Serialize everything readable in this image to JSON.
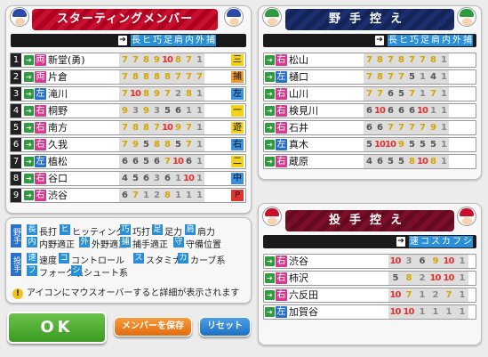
{
  "starting": {
    "title": "スターティングメンバー",
    "header_labels": [
      "長",
      "ヒ",
      "巧",
      "足",
      "肩",
      "内",
      "外",
      "捕"
    ],
    "players": [
      {
        "num": "1",
        "hand": "両",
        "name": "新堂(勇)",
        "stats": [
          "7",
          "7",
          "8",
          "9",
          "10",
          "8",
          "7",
          "1"
        ],
        "pos": "三",
        "pos_color": "#f3d21b"
      },
      {
        "num": "2",
        "hand": "両",
        "name": "片倉",
        "stats": [
          "7",
          "8",
          "8",
          "8",
          "8",
          "7",
          "7",
          "7"
        ],
        "pos": "捕",
        "pos_color": "#f09a2b"
      },
      {
        "num": "3",
        "hand": "左",
        "name": "滝川",
        "stats": [
          "7",
          "10",
          "8",
          "9",
          "7",
          "2",
          "8",
          "1"
        ],
        "pos": "左",
        "pos_color": "#3a8fe0"
      },
      {
        "num": "4",
        "hand": "右",
        "name": "桐野",
        "stats": [
          "9",
          "3",
          "9",
          "3",
          "5",
          "6",
          "1",
          "1"
        ],
        "pos": "一",
        "pos_color": "#f3d21b"
      },
      {
        "num": "5",
        "hand": "右",
        "name": "南方",
        "stats": [
          "7",
          "8",
          "8",
          "7",
          "10",
          "9",
          "7",
          "1"
        ],
        "pos": "遊",
        "pos_color": "#f3d21b"
      },
      {
        "num": "6",
        "hand": "右",
        "name": "久我",
        "stats": [
          "7",
          "9",
          "5",
          "8",
          "8",
          "5",
          "7",
          "1"
        ],
        "pos": "右",
        "pos_color": "#3a8fe0"
      },
      {
        "num": "7",
        "hand": "左",
        "name": "植松",
        "stats": [
          "6",
          "6",
          "5",
          "6",
          "7",
          "10",
          "6",
          "1"
        ],
        "pos": "二",
        "pos_color": "#f3d21b"
      },
      {
        "num": "8",
        "hand": "右",
        "name": "谷口",
        "stats": [
          "4",
          "5",
          "6",
          "3",
          "6",
          "1",
          "10",
          "1"
        ],
        "pos": "中",
        "pos_color": "#3a8fe0"
      },
      {
        "num": "9",
        "hand": "右",
        "name": "渋谷",
        "stats": [
          "6",
          "7",
          "1",
          "2",
          "8",
          "1",
          "1",
          "1"
        ],
        "pos": "P",
        "pos_color": "#e0322e"
      }
    ]
  },
  "bench_fielders": {
    "title": "野手控え",
    "header_labels": [
      "長",
      "ヒ",
      "巧",
      "足",
      "肩",
      "内",
      "外",
      "捕"
    ],
    "players": [
      {
        "hand": "右",
        "name": "松山",
        "stats": [
          "7",
          "8",
          "7",
          "8",
          "7",
          "7",
          "8",
          "1"
        ]
      },
      {
        "hand": "左",
        "name": "樋口",
        "stats": [
          "7",
          "8",
          "7",
          "7",
          "5",
          "1",
          "4",
          "1"
        ]
      },
      {
        "hand": "右",
        "name": "山川",
        "stats": [
          "7",
          "7",
          "6",
          "5",
          "7",
          "1",
          "7",
          "1"
        ]
      },
      {
        "hand": "右",
        "name": "検見川",
        "stats": [
          "6",
          "10",
          "6",
          "6",
          "6",
          "10",
          "1",
          "1"
        ]
      },
      {
        "hand": "右",
        "name": "石井",
        "stats": [
          "6",
          "6",
          "7",
          "7",
          "7",
          "7",
          "9",
          "1"
        ]
      },
      {
        "hand": "左",
        "name": "真木",
        "stats": [
          "5",
          "10",
          "10",
          "9",
          "5",
          "5",
          "5",
          "1"
        ]
      },
      {
        "hand": "右",
        "name": "蔵原",
        "stats": [
          "4",
          "6",
          "5",
          "5",
          "8",
          "10",
          "8",
          "1"
        ]
      }
    ]
  },
  "bench_pitchers": {
    "title": "投手控え",
    "header_labels": [
      "速",
      "コ",
      "ス",
      "カ",
      "フ",
      "シ"
    ],
    "players": [
      {
        "hand": "右",
        "name": "渋谷",
        "stats": [
          "10",
          "3",
          "6",
          "9",
          "10",
          "1"
        ]
      },
      {
        "hand": "右",
        "name": "柿沢",
        "stats": [
          "5",
          "8",
          "2",
          "10",
          "10",
          "1"
        ]
      },
      {
        "hand": "右",
        "name": "六反田",
        "stats": [
          "10",
          "7",
          "1",
          "2",
          "7",
          "1"
        ]
      },
      {
        "hand": "左",
        "name": "加賀谷",
        "stats": [
          "10",
          "10",
          "1",
          "1",
          "1",
          "1"
        ]
      }
    ]
  },
  "legend": {
    "fielder_tag": "野手",
    "pitcher_tag": "投手",
    "row1": [
      {
        "tag": "長",
        "label": "長打"
      },
      {
        "tag": "ヒ",
        "label": "ヒッティング"
      },
      {
        "tag": "巧",
        "label": "巧打"
      },
      {
        "tag": "足",
        "label": "足力"
      },
      {
        "tag": "肩",
        "label": "肩力"
      }
    ],
    "row2": [
      {
        "tag": "内",
        "label": "内野適正"
      },
      {
        "tag": "外",
        "label": "外野適正"
      },
      {
        "tag": "捕",
        "label": "捕手適正"
      },
      {
        "tag": "守",
        "label": "守備位置"
      }
    ],
    "row3": [
      {
        "tag": "速",
        "label": "速度"
      },
      {
        "tag": "コ",
        "label": "コントロール"
      },
      {
        "tag": "ス",
        "label": "スタミナ"
      },
      {
        "tag": "カ",
        "label": "カーブ系"
      }
    ],
    "row4": [
      {
        "tag": "フ",
        "label": "フォーク系"
      },
      {
        "tag": "シ",
        "label": "シュート系"
      }
    ]
  },
  "note": "アイコンにマウスオーバーすると詳細が表示されます",
  "buttons": {
    "ok": "OK",
    "save": "メンバーを保存",
    "reset": "リセット"
  },
  "colors": {
    "right": "#d63a8c",
    "left": "#2a6fc9",
    "both": "#d63a8c",
    "go": "#2e9b3e",
    "header": "#2a8fd6"
  }
}
